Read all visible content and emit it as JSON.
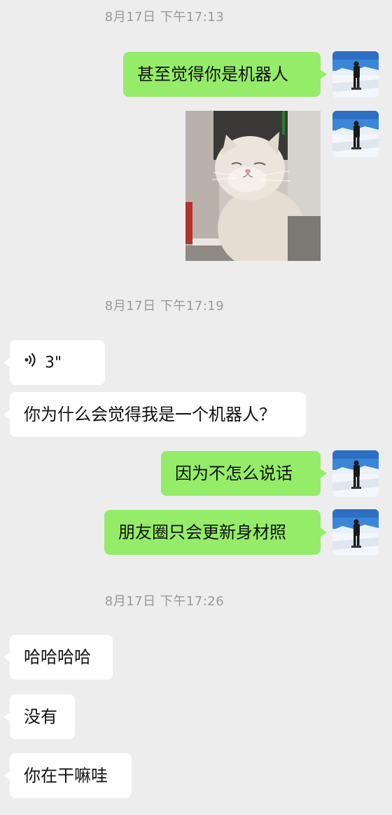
{
  "timestamps": [
    "8月17日 下午17:13",
    "8月17日 下午17:19",
    "8月17日 下午17:26"
  ],
  "messages": {
    "m1": "甚至觉得你是机器人",
    "m2_image": "cat-photo",
    "m3_voice_duration": "3\"",
    "m4": "你为什么会觉得我是一个机器人？",
    "m5": "因为不怎么说话",
    "m6": "朋友圈只会更新身材照",
    "m7": "哈哈哈哈",
    "m8": "没有",
    "m9": "你在干嘛哇"
  },
  "icons": {
    "voice": "voice-wave-icon",
    "avatar": "user-avatar-snow-photo"
  },
  "colors": {
    "background": "#ededed",
    "outgoing_bubble": "#95ec69",
    "incoming_bubble": "#ffffff",
    "timestamp_text": "#999999"
  }
}
